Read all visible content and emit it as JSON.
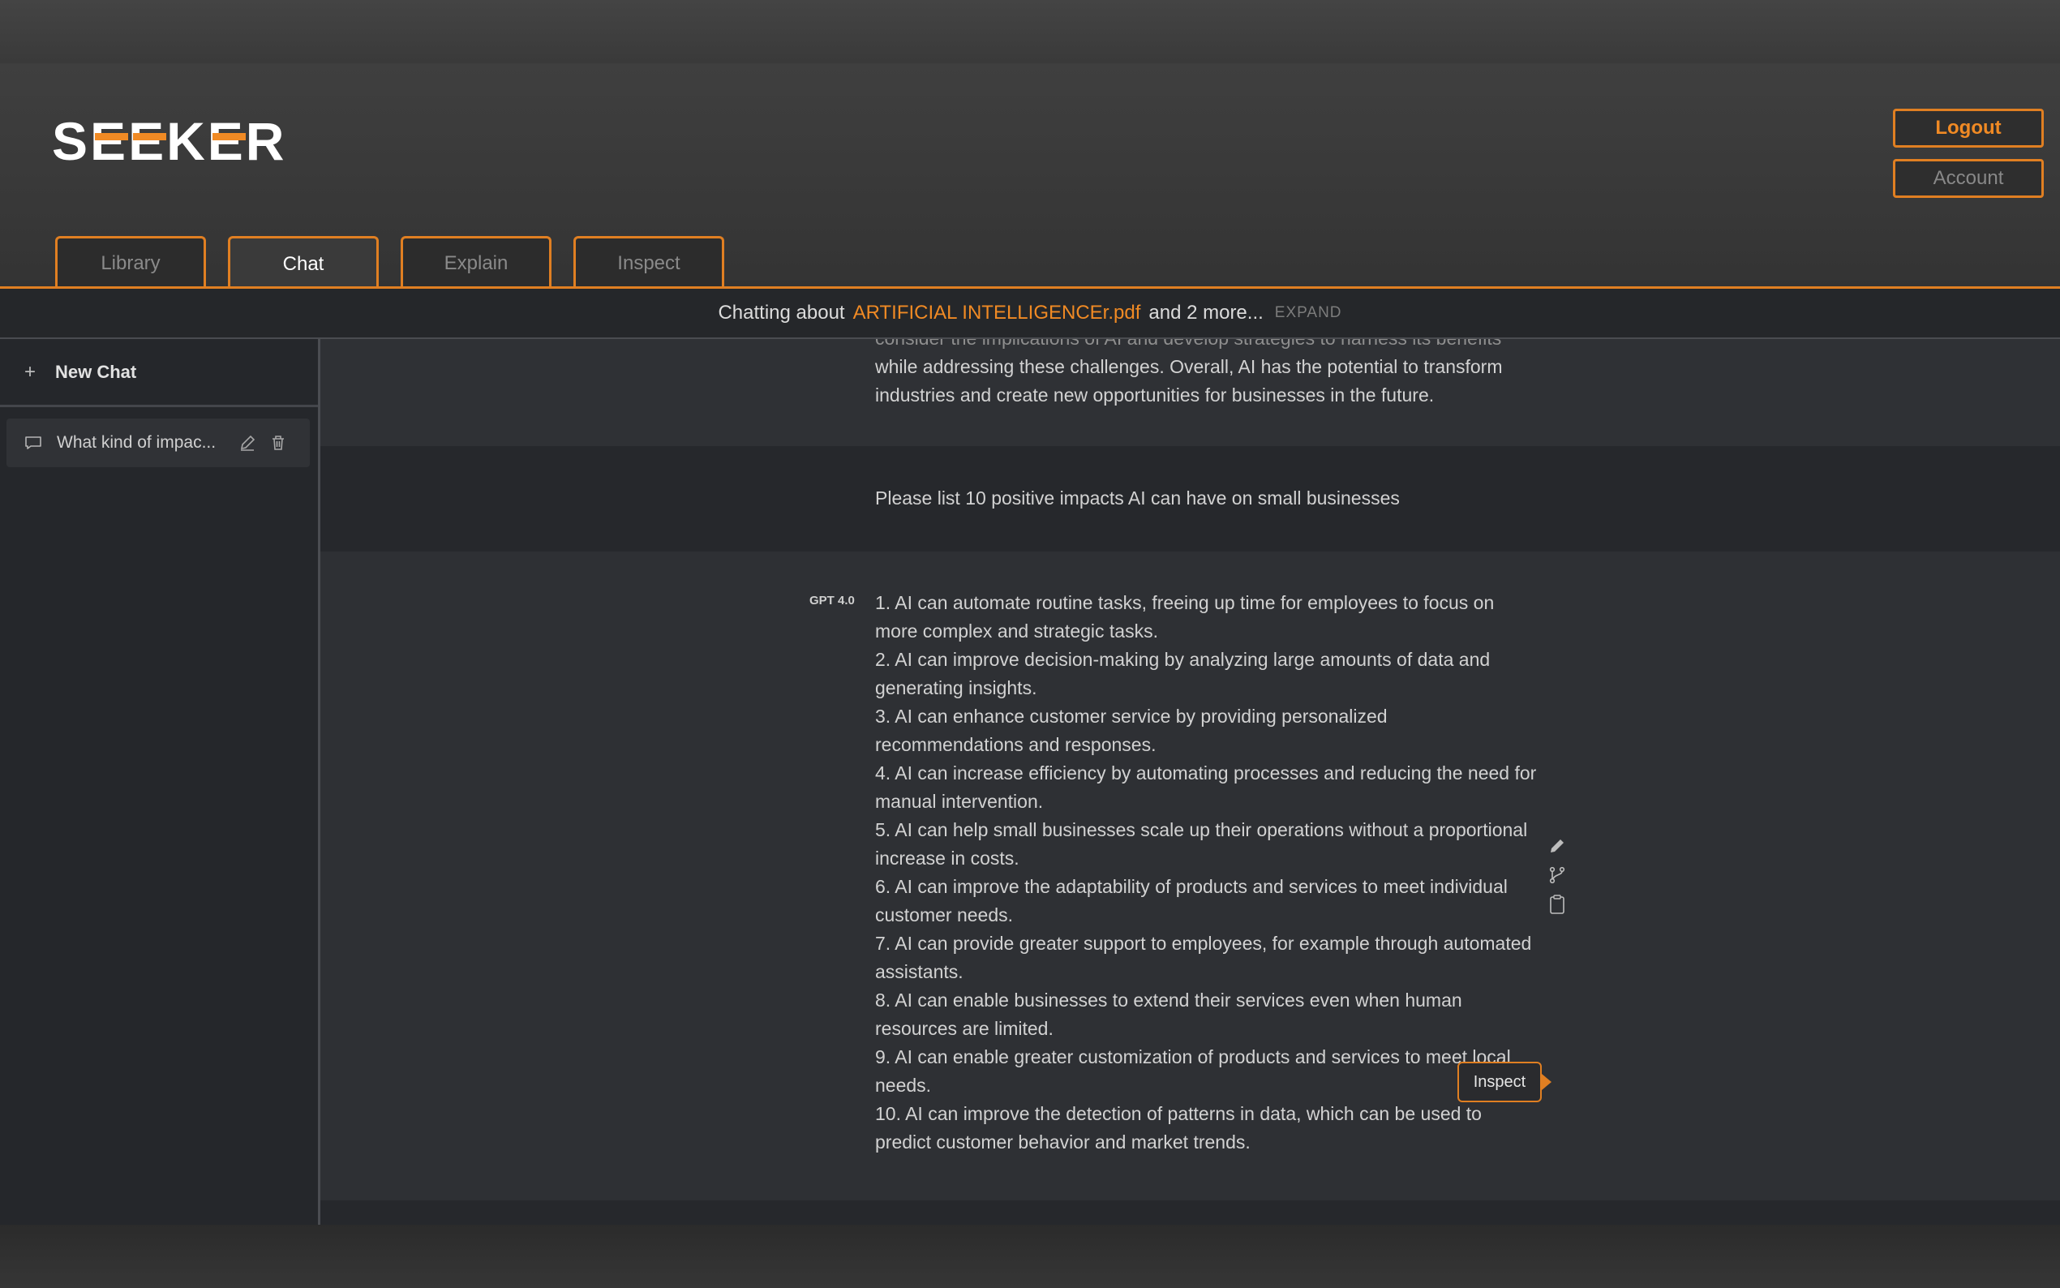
{
  "app": {
    "logo": "SEEKER"
  },
  "auth": {
    "logout": "Logout",
    "account": "Account"
  },
  "tabs": [
    {
      "label": "Library",
      "active": false
    },
    {
      "label": "Chat",
      "active": true
    },
    {
      "label": "Explain",
      "active": false
    },
    {
      "label": "Inspect",
      "active": false
    }
  ],
  "context": {
    "prefix": "Chatting about",
    "file": "ARTIFICIAL INTELLIGENCEr.pdf",
    "suffix": "and 2 more...",
    "expand": "EXPAND"
  },
  "sidebar": {
    "new_chat": "New Chat",
    "chats": [
      {
        "label": "What kind of impac..."
      }
    ]
  },
  "conversation": {
    "previous_tail": {
      "cut_line": "consider the implications of AI and develop strategies to harness its benefits",
      "rest": "while addressing these challenges. Overall, AI has the potential to transform industries and create new opportunities for businesses in the future."
    },
    "user_message": "Please list 10 positive impacts AI can have on small businesses",
    "ai_model": "GPT 4.0",
    "ai_items": [
      "1. AI can automate routine tasks, freeing up time for employees to focus on more complex and strategic tasks.",
      "2. AI can improve decision-making by analyzing large amounts of data and generating insights.",
      "3. AI can enhance customer service by providing personalized recommendations and responses.",
      "4. AI can increase efficiency by automating processes and reducing the need for manual intervention.",
      "5. AI can help small businesses scale up their operations without a proportional increase in costs.",
      "6. AI can improve the adaptability of products and services to meet individual customer needs.",
      "7. AI can provide greater support to employees, for example through automated assistants.",
      "8. AI can enable businesses to extend their services even when human resources are limited.",
      "9. AI can enable greater customization of products and services to meet local needs.",
      "10. AI can improve the detection of patterns in data, which can be used to predict customer behavior and market trends."
    ],
    "tooltip": "Inspect",
    "tools": [
      "pencil-icon",
      "branch-icon",
      "clipboard-icon"
    ]
  },
  "colors": {
    "accent": "#e07f22",
    "accent_text": "#f08a24"
  }
}
